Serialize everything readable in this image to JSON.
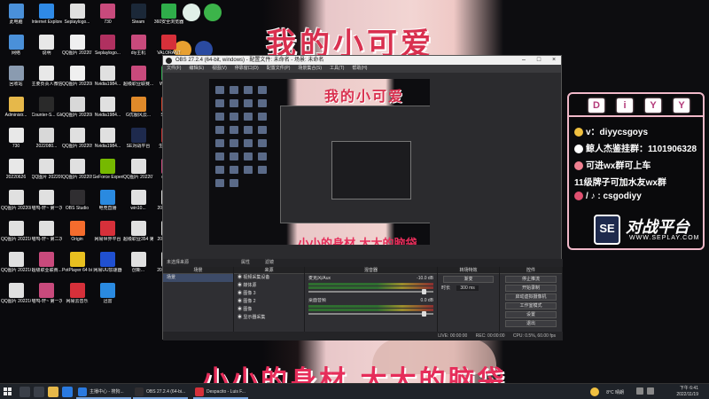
{
  "wallpaper": {
    "title": "我的小可爱",
    "bottom_text": "小小的身材 大大的脑袋"
  },
  "desktop_icons": [
    {
      "label": "此电脑",
      "icon": "computer-icon",
      "color": "#4a90d9"
    },
    {
      "label": "Internet Explorer",
      "icon": "ie-icon",
      "color": "#2f8ae6"
    },
    {
      "label": "Seplaylogo...",
      "icon": "image-icon",
      "color": "#e0e0e0"
    },
    {
      "label": "730",
      "icon": "archive-icon",
      "color": "#c84a7c"
    },
    {
      "label": "Steam",
      "icon": "steam-icon",
      "color": "#1b2838"
    },
    {
      "label": "360安全浏览器",
      "icon": "browser-icon",
      "color": "#2fae4a"
    },
    {
      "label": "网络",
      "icon": "network-icon",
      "color": "#4a90d9"
    },
    {
      "label": "说明",
      "icon": "doc-icon",
      "color": "#e8e8e8"
    },
    {
      "label": "QQ图片 20220711...",
      "icon": "image-icon",
      "color": "#f0f0f0"
    },
    {
      "label": "Seplaylogo...",
      "icon": "archive-icon",
      "color": "#b03060"
    },
    {
      "label": "diy主机",
      "icon": "archive-icon",
      "color": "#c84a7c"
    },
    {
      "label": "VALORANT",
      "icon": "valorant-icon",
      "color": "#d6303a"
    },
    {
      "label": "回收站",
      "icon": "recycle-bin-icon",
      "color": "#8a9bb0"
    },
    {
      "label": "主要负责人微信群...",
      "icon": "doc-icon",
      "color": "#e8e8e8"
    },
    {
      "label": "QQ图片 20220814...",
      "icon": "image-icon",
      "color": "#f0f0f0"
    },
    {
      "label": "Nvidia1984...",
      "icon": "image-icon",
      "color": "#e0e0e0"
    },
    {
      "label": "超级职业联赛...",
      "icon": "archive-icon",
      "color": "#c84a7c"
    },
    {
      "label": "WeGame",
      "icon": "wegame-icon",
      "color": "#2da24d"
    },
    {
      "label": "Administr...",
      "icon": "folder-icon",
      "color": "#e6b84a"
    },
    {
      "label": "Counter-S... Global Off...",
      "icon": "csgo-icon",
      "color": "#2a2a2a"
    },
    {
      "label": "QQ图片 20220814...",
      "icon": "image-icon",
      "color": "#d8d8d8"
    },
    {
      "label": "Nvidia1984...",
      "icon": "image-icon",
      "color": "#e0e0e0"
    },
    {
      "label": "G优服风云...",
      "icon": "game-icon",
      "color": "#e08a2a"
    },
    {
      "label": "S单数量",
      "icon": "s-icon",
      "color": "#d0402a"
    },
    {
      "label": "730",
      "icon": "doc-icon",
      "color": "#e8e8e8"
    },
    {
      "label": "2022080...",
      "icon": "image-icon",
      "color": "#d8d8d8"
    },
    {
      "label": "QQ图片 20220906...",
      "icon": "image-icon",
      "color": "#e0e0e0"
    },
    {
      "label": "Nvidia1984...",
      "icon": "image-icon",
      "color": "#e0e0e0"
    },
    {
      "label": "SE对战平台",
      "icon": "se-icon",
      "color": "#1e2a4d"
    },
    {
      "label": "生死狙击2",
      "icon": "game-icon",
      "color": "#c03030"
    },
    {
      "label": "20220626",
      "icon": "doc-icon",
      "color": "#e8e8e8"
    },
    {
      "label": "QQ图片 20220906...",
      "icon": "image-icon",
      "color": "#e0e0e0"
    },
    {
      "label": "QQ图片 20220906...",
      "icon": "image-icon",
      "color": "#e0e0e0"
    },
    {
      "label": "GeForce Experience",
      "icon": "nvidia-icon",
      "color": "#76b900"
    },
    {
      "label": "QQ图片 20220712...",
      "icon": "image-icon",
      "color": "#e0e0e0"
    },
    {
      "label": "diy电脑",
      "icon": "archive-icon",
      "color": "#c84a7c"
    },
    {
      "label": "QQ图片 20220804...",
      "icon": "image-icon",
      "color": "#e0e0e0"
    },
    {
      "label": "喵呜-轩~ 第一次...",
      "icon": "image-icon",
      "color": "#e0e0e0"
    },
    {
      "label": "OBS Studio",
      "icon": "obs-icon",
      "color": "#302e31"
    },
    {
      "label": "电竞直播",
      "icon": "live-icon",
      "color": "#2a8ae0"
    },
    {
      "label": "win10...",
      "icon": "image-icon",
      "color": "#e0e0e0"
    },
    {
      "label": "20221104...",
      "icon": "image-icon",
      "color": "#d8d8d8"
    },
    {
      "label": "QQ图片 20221021...",
      "icon": "image-icon",
      "color": "#e0e0e0"
    },
    {
      "label": "喵呜-轩~ 第二次...",
      "icon": "image-icon",
      "color": "#e0e0e0"
    },
    {
      "label": "Origin",
      "icon": "origin-icon",
      "color": "#f56c2d"
    },
    {
      "label": "网易世界平台",
      "icon": "netease-icon",
      "color": "#d6303a"
    },
    {
      "label": "超级职业354 第...",
      "icon": "image-icon",
      "color": "#e0e0e0"
    },
    {
      "label": "20221107...",
      "icon": "image-icon",
      "color": "#d8d8d8"
    },
    {
      "label": "QQ图片 20221021...",
      "icon": "image-icon",
      "color": "#e0e0e0"
    },
    {
      "label": "超级职业联赛...",
      "icon": "archive-icon",
      "color": "#c84a7c"
    },
    {
      "label": "PotPlayer 64 bit",
      "icon": "potplayer-icon",
      "color": "#e8c020"
    },
    {
      "label": "网易UU加速器",
      "icon": "uu-icon",
      "color": "#2050d0"
    },
    {
      "label": "创新...",
      "icon": "image-icon",
      "color": "#e0e0e0"
    },
    {
      "label": "20220625...",
      "icon": "image-icon",
      "color": "#d8d8d8"
    },
    {
      "label": "QQ图片 20221021...",
      "icon": "image-icon",
      "color": "#e0e0e0"
    },
    {
      "label": "喵呜-轩~ 第一次...",
      "icon": "archive-icon",
      "color": "#c84a7c"
    },
    {
      "label": "网易云音乐",
      "icon": "music-icon",
      "color": "#d6303a"
    },
    {
      "label": "迅雷",
      "icon": "thunder-icon",
      "color": "#2a8ae0"
    }
  ],
  "obs": {
    "window_title": "OBS 27.2.4 (64-bit, windows) - 配置文件: 未命名 - 场景: 未命名",
    "menu": [
      "文件(F)",
      "编辑(E)",
      "视图(V)",
      "停靠窗口(D)",
      "配置文件(P)",
      "场景集合(S)",
      "工具(T)",
      "帮助(H)"
    ],
    "preview_title": "我的小可爱",
    "preview_bottom": "小小的身材 大大的脑袋",
    "scenes_header": "场景",
    "scenes": [
      "场景"
    ],
    "sources_header": "来源",
    "sources": [
      "视频采集设备",
      "媒体源",
      "图像 3",
      "图像 2",
      "图像",
      "显示器采集"
    ],
    "mixer_header": "混音器",
    "mixer": [
      {
        "name": "麦克风/Aux",
        "db": "-10.0 dB"
      },
      {
        "name": "桌面音频",
        "db": "0.0 dB"
      }
    ],
    "transitions_header": "转场特效",
    "transition": "渐变",
    "duration_label": "时长",
    "duration": "300 ms",
    "controls_header": "控件",
    "controls": [
      "停止推流",
      "开始录制",
      "启动虚拟摄像机",
      "工作室模式",
      "设置",
      "退出"
    ],
    "no_source": "未选择来源",
    "properties_label": "属性",
    "filters_label": "滤镜",
    "status": {
      "live": "LIVE: 00:00:00",
      "rec": "REC: 00:00:00",
      "cpu": "CPU: 0.5%, 60.00 fps"
    }
  },
  "overlay": {
    "letters": [
      "D",
      "i",
      "Y",
      "Y"
    ],
    "lines": [
      {
        "text": "v：diyycsgoys",
        "icon": "key-icon",
        "color": "#f0c040"
      },
      {
        "text": "鲸人杰鉴挂群：1101906328",
        "icon": "penguin-icon",
        "color": "#ffffff"
      },
      {
        "text": "可进wx群可上车",
        "icon": "heart-icon",
        "color": "#f08090"
      },
      {
        "text": "11级牌子可加水友wx群",
        "icon": "",
        "color": ""
      },
      {
        "text": "/  ♪ : csgodiyy",
        "icon": "camera-icon",
        "color": "#e05070"
      }
    ],
    "brand_badge": "SE",
    "brand_name": "对战平台",
    "brand_url": "WWW.SEPLAY.COM"
  },
  "taskbar": {
    "tasks": [
      {
        "label": "主播中心 - 搜狗...",
        "color": "#2a7ae0"
      },
      {
        "label": "OBS 27.2.4 (64-bi...",
        "color": "#302e31"
      },
      {
        "label": "Despacito - Luis F...",
        "color": "#d6303a"
      }
    ],
    "weather": "8°C 晴朗",
    "time": "下午 6:41",
    "date": "2022/11/19"
  }
}
